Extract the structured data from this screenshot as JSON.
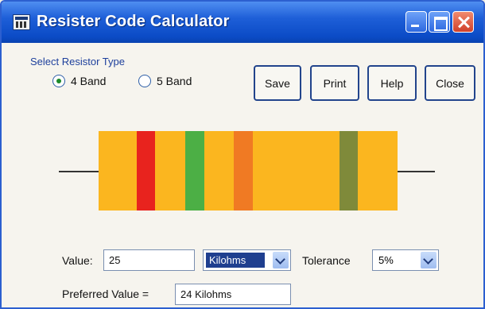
{
  "window": {
    "title": "Resister Code Calculator",
    "icon": "calculator-app-icon"
  },
  "resistor_type": {
    "label": "Select Resistor Type",
    "options": [
      {
        "label": "4 Band",
        "selected": true
      },
      {
        "label": "5 Band",
        "selected": false
      }
    ]
  },
  "toolbar": {
    "save_label": "Save",
    "print_label": "Print",
    "help_label": "Help",
    "close_label": "Close"
  },
  "resistor": {
    "body_color": "#fbb61f",
    "bands": [
      {
        "name": "band-1",
        "color": "#e8231e"
      },
      {
        "name": "band-2",
        "color": "#4caf45"
      },
      {
        "name": "band-3",
        "color": "#f07a23"
      },
      {
        "name": "band-4",
        "color": "#7f8a3a"
      }
    ]
  },
  "value_field": {
    "label": "Value:",
    "value": "25"
  },
  "unit_select": {
    "selected": "Kilohms"
  },
  "tolerance": {
    "label": "Tolerance",
    "selected": "5%"
  },
  "preferred": {
    "label": "Preferred Value =",
    "value": "24 Kilohms"
  }
}
